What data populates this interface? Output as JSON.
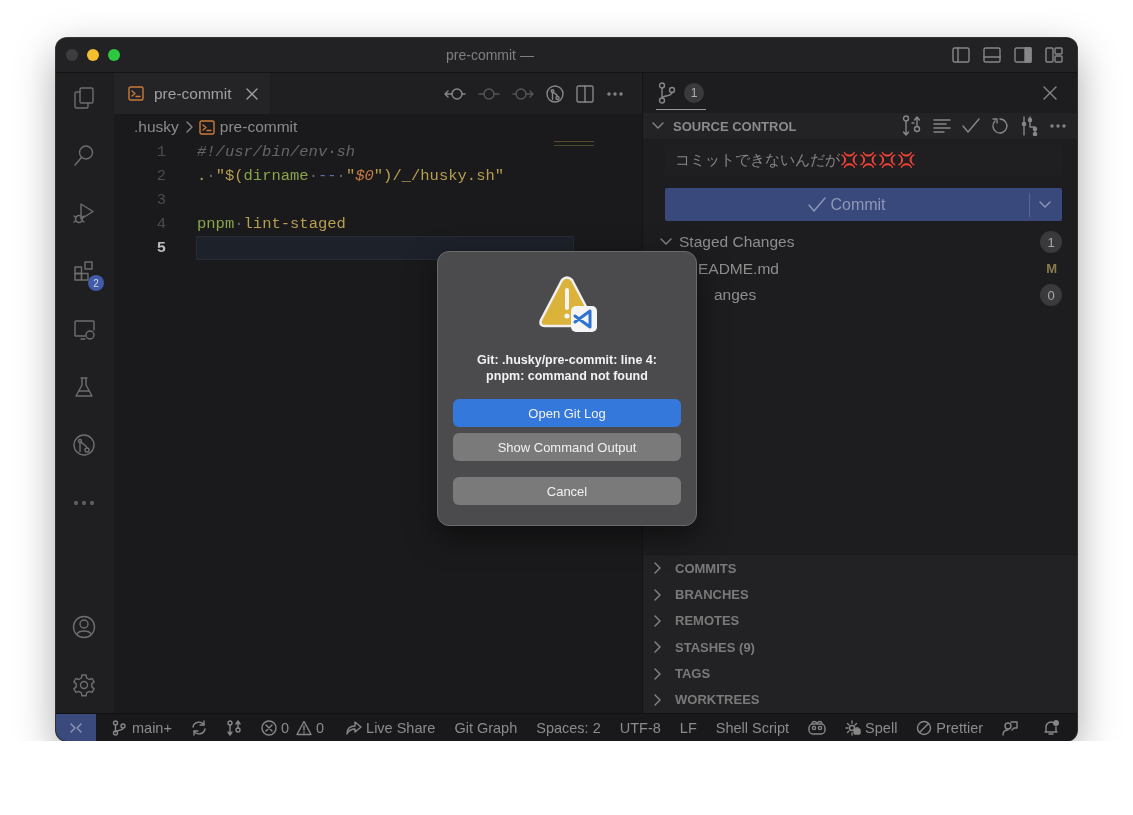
{
  "window": {
    "title": "pre-commit —"
  },
  "activity_bar": {
    "top": [
      {
        "kind": "files"
      },
      {
        "kind": "search"
      },
      {
        "kind": "debug"
      },
      {
        "kind": "extensions",
        "badge": "2"
      },
      {
        "kind": "remote"
      },
      {
        "kind": "testing"
      },
      {
        "kind": "gitgraph"
      },
      {
        "kind": "more"
      }
    ],
    "bottom": [
      {
        "kind": "account"
      },
      {
        "kind": "settings"
      }
    ]
  },
  "editor": {
    "tabs": [
      {
        "label": "pre-commit",
        "selected": true
      }
    ],
    "breadcrumb": [
      ".husky",
      "pre-commit"
    ],
    "lines": [
      {
        "number": "1",
        "current": false,
        "tokens": [
          {
            "kind": "comment",
            "text": "#!/usr/bin/env"
          },
          {
            "kind": "space",
            "text": "·"
          },
          {
            "kind": "comment",
            "text": "sh"
          }
        ]
      },
      {
        "number": "2",
        "current": false,
        "tokens": [
          {
            "kind": "plain",
            "text": "."
          },
          {
            "kind": "space",
            "text": "·"
          },
          {
            "kind": "string",
            "text": "\"$("
          },
          {
            "kind": "command",
            "text": "dirname"
          },
          {
            "kind": "space",
            "text": "·"
          },
          {
            "kind": "operator",
            "text": "--"
          },
          {
            "kind": "space",
            "text": "·"
          },
          {
            "kind": "string",
            "text": "\""
          },
          {
            "kind": "variable",
            "text": "$0"
          },
          {
            "kind": "string",
            "text": "\")/_/husky.sh\""
          }
        ]
      },
      {
        "number": "3",
        "current": false
      },
      {
        "number": "4",
        "current": false,
        "tokens": [
          {
            "kind": "command",
            "text": "pnpm"
          },
          {
            "kind": "space",
            "text": "·"
          },
          {
            "kind": "string",
            "text": "lint-staged"
          }
        ]
      },
      {
        "number": "5",
        "current": true
      }
    ]
  },
  "source_control": {
    "tab_badge": "1",
    "title": "SOURCE CONTROL",
    "message": "コミットできないんだが💢💢💢💢",
    "commit_button": "Commit",
    "groups": [
      {
        "label": "Staged Changes",
        "count": "1",
        "files": [
          {
            "name": "EADME.md",
            "status": "M"
          }
        ]
      },
      {
        "label": "anges",
        "count": "0"
      }
    ],
    "sections": [
      {
        "label": "COMMITS",
        "expanded": false
      },
      {
        "label": "BRANCHES",
        "expanded": false
      },
      {
        "label": "REMOTES",
        "expanded": false
      },
      {
        "label": "STASHES (9)",
        "expanded": false
      },
      {
        "label": "TAGS",
        "expanded": false
      },
      {
        "label": "WORKTREES",
        "expanded": false
      }
    ]
  },
  "dialog": {
    "message": "Git: .husky/pre-commit: line 4: pnpm: command not found",
    "buttons": [
      {
        "label": "Open Git Log",
        "kind": "primary"
      },
      {
        "label": "Show Command Output",
        "kind": "secondary"
      },
      {
        "label": "Cancel",
        "kind": "cancel"
      }
    ]
  },
  "status_bar": [
    {
      "kind": "remote"
    },
    {
      "kind": "branch",
      "text": "main+"
    },
    {
      "kind": "sync"
    },
    {
      "kind": "scm"
    },
    {
      "kind": "problems",
      "errors": "0",
      "warnings": "0"
    },
    {
      "kind": "liveshare",
      "text": "Live Share"
    },
    {
      "kind": "text",
      "text": "Git Graph"
    },
    {
      "kind": "text",
      "text": "Spaces: 2"
    },
    {
      "kind": "text",
      "text": "UTF-8"
    },
    {
      "kind": "text",
      "text": "LF"
    },
    {
      "kind": "text",
      "text": "Shell Script"
    },
    {
      "kind": "copilot"
    },
    {
      "kind": "spell",
      "text": "Spell"
    },
    {
      "kind": "prettier",
      "text": "Prettier"
    },
    {
      "kind": "feedback"
    },
    {
      "kind": "bell"
    }
  ]
}
